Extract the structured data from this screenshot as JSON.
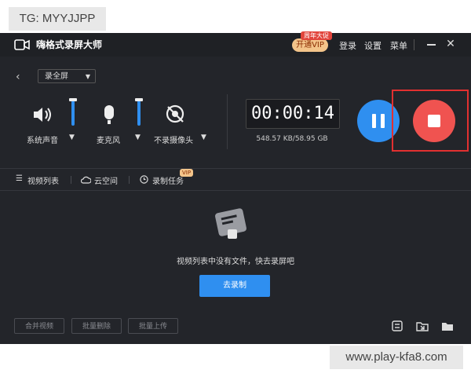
{
  "watermarks": {
    "top": "TG: MYYJJPP",
    "bottom": "www.play-kfa8.com"
  },
  "titlebar": {
    "app_title": "嗨格式录屏大师",
    "vip_button": "开通VIP",
    "vip_badge": "周年大促",
    "login": "登录",
    "settings": "设置",
    "menu": "菜单"
  },
  "mode": {
    "selected": "录全屏"
  },
  "controls": [
    {
      "label": "系统声音",
      "icon": "speaker-icon"
    },
    {
      "label": "麦克风",
      "icon": "microphone-icon"
    },
    {
      "label": "不录摄像头",
      "icon": "camera-off-icon"
    }
  ],
  "recording": {
    "timer": "00:00:14",
    "size": "548.57 KB/58.95 GB"
  },
  "tabs": [
    {
      "label": "视频列表",
      "icon": "list-icon"
    },
    {
      "label": "云空间",
      "icon": "cloud-icon"
    },
    {
      "label": "录制任务",
      "icon": "clock-icon",
      "badge": "VIP"
    }
  ],
  "empty_state": {
    "message": "视频列表中没有文件，快去录屏吧",
    "button": "去录制"
  },
  "bottom_actions": [
    "合并视频",
    "批量删除",
    "批量上传"
  ],
  "colors": {
    "accent": "#2f8ff0",
    "stop": "#f05350",
    "background": "#23252a",
    "highlight": "#e23030"
  }
}
